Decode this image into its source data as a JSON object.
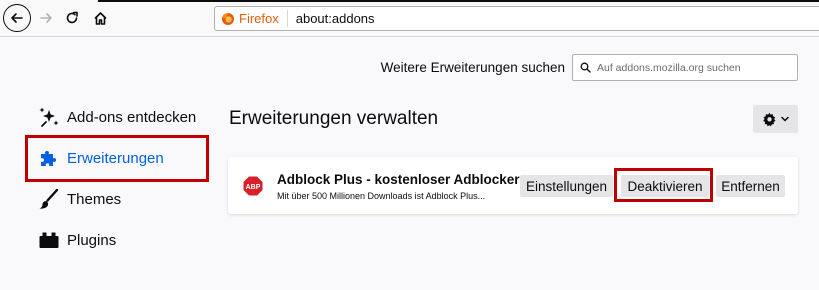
{
  "browser": {
    "identity_label": "Firefox",
    "url": "about:addons",
    "icons": {
      "back": "back-arrow-icon",
      "forward": "forward-arrow-icon",
      "reload": "reload-icon",
      "home": "home-icon",
      "identity": "firefox-logo-icon"
    }
  },
  "search": {
    "label": "Weitere Erweiterungen suchen",
    "placeholder": "Auf addons.mozilla.org suchen"
  },
  "sidebar": {
    "items": [
      {
        "label": "Add-ons entdecken",
        "icon": "discover-sparkle-icon"
      },
      {
        "label": "Erweiterungen",
        "icon": "puzzle-piece-icon",
        "selected": true
      },
      {
        "label": "Themes",
        "icon": "brush-icon"
      },
      {
        "label": "Plugins",
        "icon": "plugin-block-icon"
      }
    ]
  },
  "main": {
    "heading": "Erweiterungen verwalten",
    "tools_icon": "gear-icon",
    "addon": {
      "name": "Adblock Plus - kostenloser Adblocker",
      "description": "Mit über 500 Millionen Downloads ist Adblock Plus...",
      "icon_text": "ABP",
      "buttons": {
        "settings": "Einstellungen",
        "disable": "Deaktivieren",
        "remove": "Entfernen"
      }
    }
  },
  "colors": {
    "highlight": "#c00000",
    "accent": "#0060df",
    "abp_red": "#d8202a",
    "firefox_orange": "#e55b0a"
  }
}
